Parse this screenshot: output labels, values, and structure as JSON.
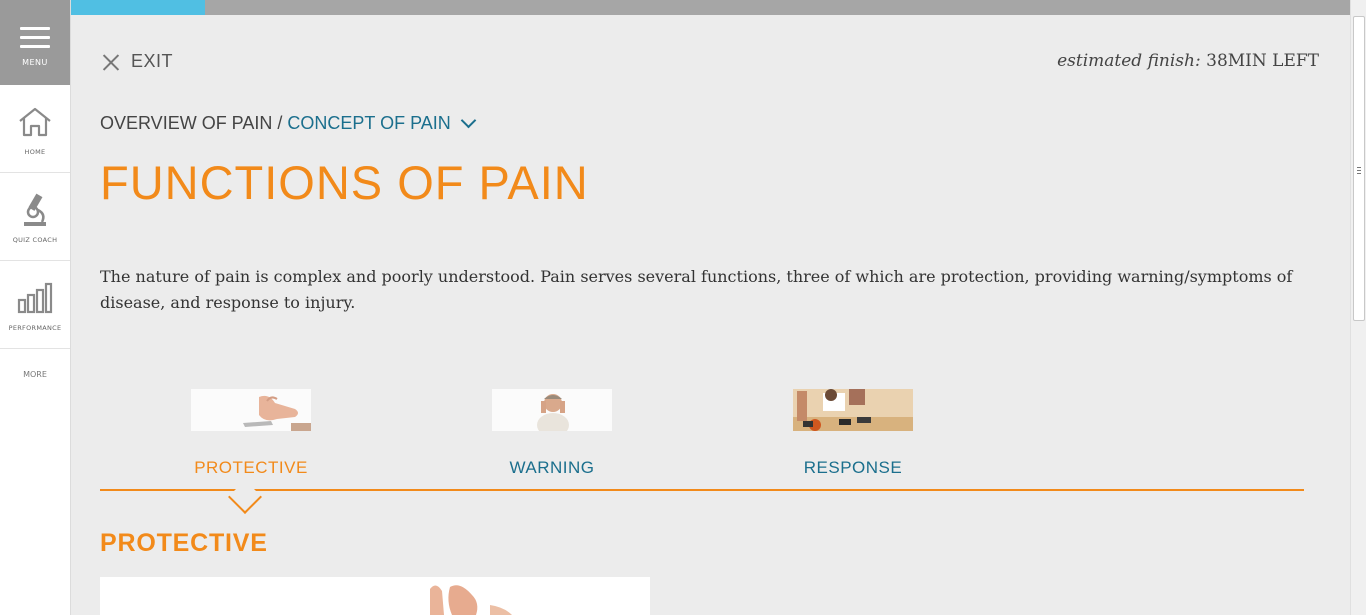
{
  "sidebar": {
    "menu_label": "MENU",
    "items": [
      {
        "label": "HOME",
        "icon": "home-icon"
      },
      {
        "label": "QUIZ COACH",
        "icon": "microscope-icon"
      },
      {
        "label": "PERFORMANCE",
        "icon": "bar-chart-icon"
      }
    ],
    "more_label": "MORE"
  },
  "progress": {
    "percent": 10.5,
    "fill_color": "#50bfe3",
    "track_color": "#a6a6a6"
  },
  "header": {
    "exit_label": "EXIT",
    "finish_prefix": "estimated finish:",
    "finish_value": "38MIN LEFT"
  },
  "breadcrumb": {
    "parent": "OVERVIEW OF PAIN",
    "separator": "/",
    "current": "CONCEPT OF PAIN"
  },
  "page_title": "FUNCTIONS OF PAIN",
  "intro_text": "The nature of pain is complex and poorly understood. Pain serves several functions, three of which are protection, providing warning/symptoms of disease, and response to injury.",
  "tabs": [
    {
      "label": "PROTECTIVE",
      "active": true
    },
    {
      "label": "WARNING",
      "active": false
    },
    {
      "label": "RESPONSE",
      "active": false
    }
  ],
  "section_title": "PROTECTIVE",
  "colors": {
    "accent": "#f28a1a",
    "link": "#1b6f8d",
    "sidebar_menu": "#9a9a9a"
  }
}
